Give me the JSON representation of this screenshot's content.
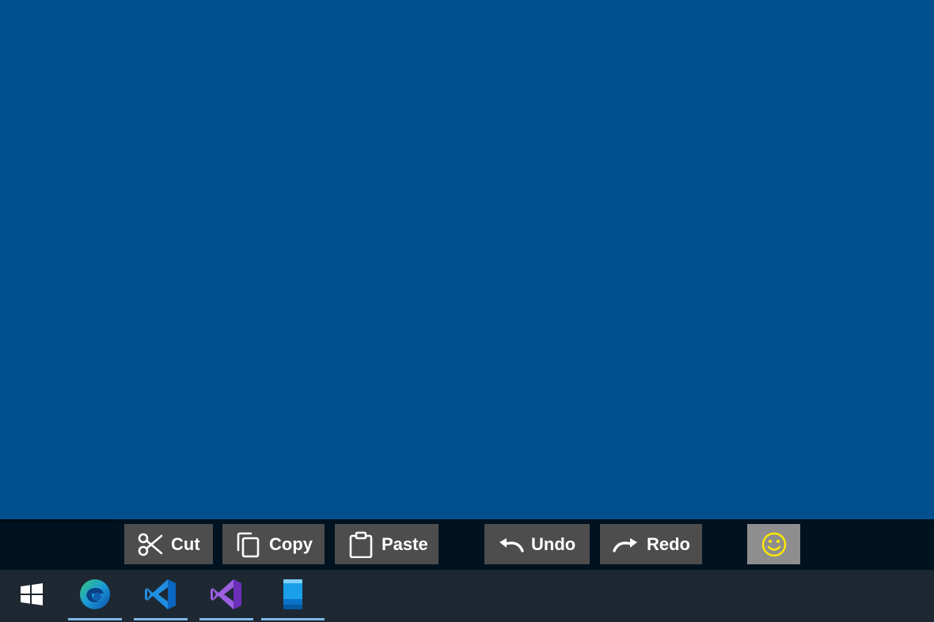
{
  "edit_toolbar": {
    "cut_label": "Cut",
    "copy_label": "Copy",
    "paste_label": "Paste",
    "undo_label": "Undo",
    "redo_label": "Redo",
    "icons": {
      "cut": "scissors-icon",
      "copy": "copy-icon",
      "paste": "clipboard-icon",
      "undo": "undo-icon",
      "redo": "redo-icon",
      "emoji": "smiley-icon"
    }
  },
  "taskbar": {
    "apps": [
      {
        "name": "start",
        "icon": "windows-logo-icon",
        "running": false
      },
      {
        "name": "edge",
        "icon": "edge-icon",
        "running": true
      },
      {
        "name": "vscode",
        "icon": "vscode-icon",
        "running": true
      },
      {
        "name": "visual-studio",
        "icon": "visual-studio-icon",
        "running": true
      },
      {
        "name": "phone",
        "icon": "phone-icon",
        "running": true
      }
    ]
  },
  "colors": {
    "desktop": "#005090",
    "edit_bar": "#011220",
    "button": "#4d4d4d",
    "emoji_button": "#8e8e8e",
    "emoji": "#ffea00",
    "taskbar": "#1e2832",
    "running_indicator": "#7fb8e6"
  }
}
